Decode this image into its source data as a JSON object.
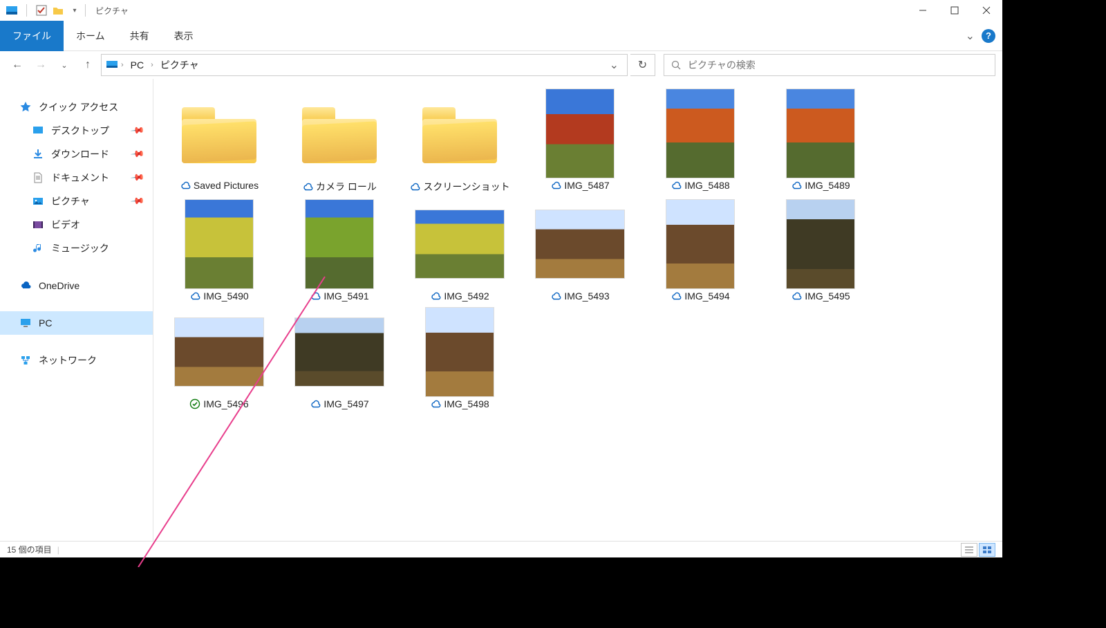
{
  "window": {
    "title": "ピクチャ",
    "tabs": {
      "file": "ファイル",
      "home": "ホーム",
      "share": "共有",
      "view": "表示"
    }
  },
  "breadcrumb": {
    "pc": "PC",
    "folder": "ピクチャ"
  },
  "search": {
    "placeholder": "ピクチャの検索"
  },
  "nav": {
    "quick_access": "クイック アクセス",
    "desktop": "デスクトップ",
    "downloads": "ダウンロード",
    "documents": "ドキュメント",
    "pictures": "ピクチャ",
    "videos": "ビデオ",
    "music": "ミュージック",
    "onedrive": "OneDrive",
    "pc": "PC",
    "network": "ネットワーク"
  },
  "items": [
    {
      "kind": "folder",
      "name": "Saved Pictures",
      "status": "cloud"
    },
    {
      "kind": "folder",
      "name": "カメラ ロール",
      "status": "cloud"
    },
    {
      "kind": "folder",
      "name": "スクリーンショット",
      "status": "cloud"
    },
    {
      "kind": "image",
      "name": "IMG_5487",
      "status": "cloud",
      "orient": "tall",
      "tone": "t-red"
    },
    {
      "kind": "image",
      "name": "IMG_5488",
      "status": "cloud",
      "orient": "tall",
      "tone": "t-org"
    },
    {
      "kind": "image",
      "name": "IMG_5489",
      "status": "cloud",
      "orient": "tall",
      "tone": "t-org"
    },
    {
      "kind": "image",
      "name": "IMG_5490",
      "status": "cloud",
      "orient": "tall",
      "tone": "t-yel"
    },
    {
      "kind": "image",
      "name": "IMG_5491",
      "status": "cloud",
      "orient": "tall",
      "tone": "t-grn"
    },
    {
      "kind": "image",
      "name": "IMG_5492",
      "status": "cloud",
      "orient": "wide",
      "tone": "t-yel"
    },
    {
      "kind": "image",
      "name": "IMG_5493",
      "status": "cloud",
      "orient": "wide",
      "tone": "t-row"
    },
    {
      "kind": "image",
      "name": "IMG_5494",
      "status": "cloud",
      "orient": "tall",
      "tone": "t-row"
    },
    {
      "kind": "image",
      "name": "IMG_5495",
      "status": "cloud",
      "orient": "tall",
      "tone": "t-dark"
    },
    {
      "kind": "image",
      "name": "IMG_5496",
      "status": "synced",
      "orient": "wide",
      "tone": "t-row"
    },
    {
      "kind": "image",
      "name": "IMG_5497",
      "status": "cloud",
      "orient": "wide",
      "tone": "t-dark"
    },
    {
      "kind": "image",
      "name": "IMG_5498",
      "status": "cloud",
      "orient": "tall",
      "tone": "t-row"
    }
  ],
  "status": {
    "count_text": "15 個の項目"
  }
}
